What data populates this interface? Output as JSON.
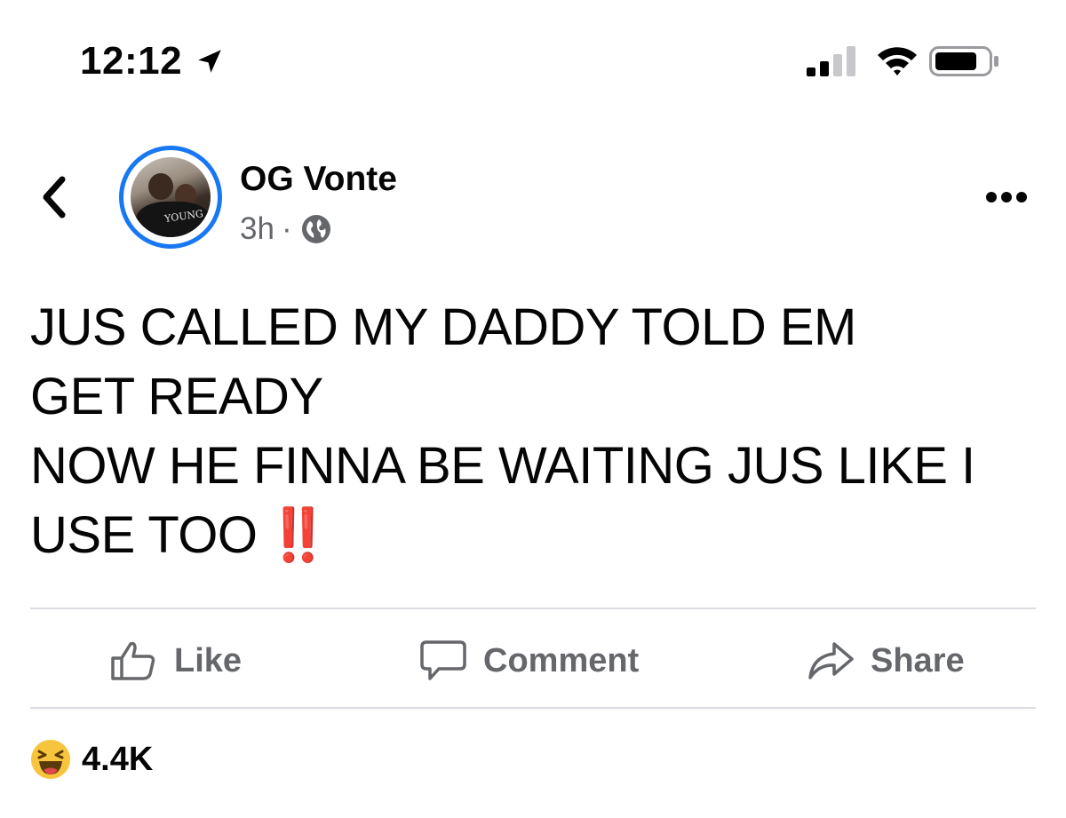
{
  "status_bar": {
    "time": "12:12"
  },
  "post": {
    "author": "OG Vonte",
    "timestamp": "3h",
    "separator": "·",
    "text_lines": [
      "JUS CALLED MY DADDY TOLD EM",
      "GET READY",
      "NOW HE FINNA BE WAITING JUS LIKE I",
      "USE TOO"
    ],
    "emoji": "‼️",
    "avatar_text": "YOUNG"
  },
  "actions": {
    "like": "Like",
    "comment": "Comment",
    "share": "Share"
  },
  "reactions": {
    "count": "4.4K",
    "icon": "haha-emoji-icon"
  },
  "colors": {
    "accent": "#1877f2",
    "secondary_text": "#65676b",
    "divider": "#dadde1",
    "emoji_red": "#dd2e44"
  }
}
